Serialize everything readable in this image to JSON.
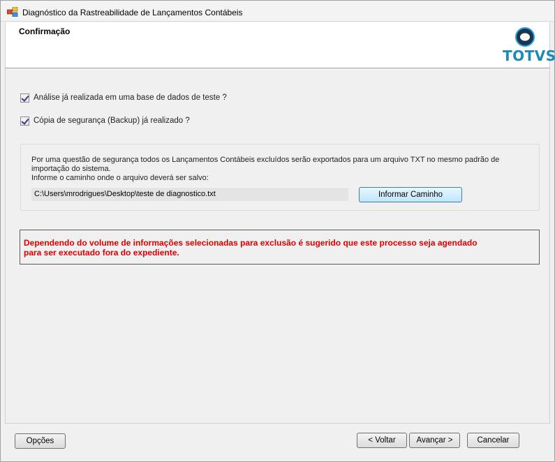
{
  "window": {
    "title": "Diagnóstico da Rastreabilidade de Lançamentos Contábeis"
  },
  "header": {
    "title": "Confirmação",
    "logo_text": "TOTVS"
  },
  "checks": [
    {
      "label": "Análise já realizada em uma base de dados de teste ?",
      "checked": true
    },
    {
      "label": "Cópia de segurança (Backup) já realizado ?",
      "checked": true
    }
  ],
  "export": {
    "line1": "Por uma questão de segurança todos os Lançamentos Contábeis excluídos serão exportados para um arquivo TXT no mesmo padrão de",
    "line2": "importação do sistema.",
    "line3": "Informe o caminho onde o arquivo deverá ser salvo:",
    "path_value": "C:\\Users\\mrodrigues\\Desktop\\teste de diagnostico.txt",
    "browse_label": "Informar Caminho"
  },
  "warning": {
    "line1": "Dependendo do volume de informações selecionadas para exclusão é sugerido que este processo seja agendado",
    "line2": "para ser executado fora do expediente."
  },
  "footer": {
    "options_label": "Opções",
    "back_label": "< Voltar",
    "next_label": "Avançar >",
    "cancel_label": "Cancelar"
  },
  "colors": {
    "warning": "#e00000",
    "logo": "#1e88b8"
  }
}
